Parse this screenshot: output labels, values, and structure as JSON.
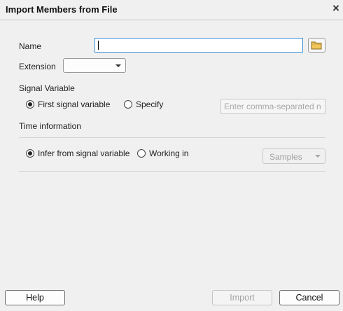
{
  "dialog": {
    "title": "Import Members from File",
    "close_glyph": "×"
  },
  "name_field": {
    "label": "Name",
    "value": "",
    "browse_icon": "folder-icon"
  },
  "extension": {
    "label": "Extension",
    "selected": ""
  },
  "signal_variable": {
    "heading": "Signal Variable",
    "options": [
      "First signal variable",
      "Specify"
    ],
    "selected_index": 0,
    "specify_placeholder": "Enter comma-separated n"
  },
  "time_information": {
    "heading": "Time information",
    "options": [
      "Infer from signal variable",
      "Working in"
    ],
    "selected_index": 0,
    "units_selected": "Samples"
  },
  "footer": {
    "help_label": "Help",
    "import_label": "Import",
    "cancel_label": "Cancel"
  },
  "colors": {
    "focus_border": "#3b8ed6",
    "background": "#f0f0f0",
    "folder_icon": "#f2c55c"
  }
}
